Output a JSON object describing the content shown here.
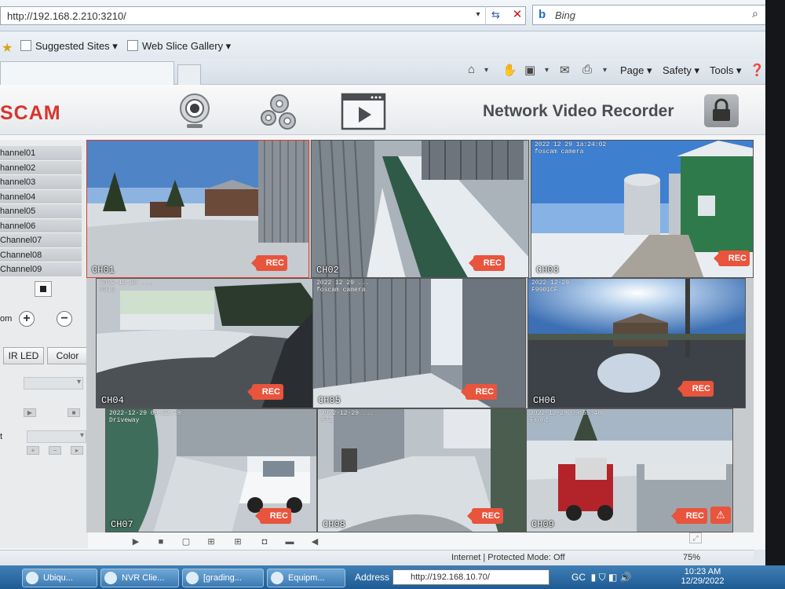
{
  "browser": {
    "url": "http://192.168.2.210:3210/",
    "search_placeholder": "Bing",
    "favorites": [
      "Suggested Sites ▾",
      "Web Slice Gallery ▾"
    ],
    "commands": {
      "page": "Page ▾",
      "safety": "Safety ▾",
      "tools": "Tools ▾"
    }
  },
  "app": {
    "logo": "SCAM",
    "title": "Network Video Recorder",
    "header_icons": [
      "camera-icon",
      "settings-gears-icon",
      "playback-icon",
      "lock-icon"
    ]
  },
  "sidebar": {
    "channels": [
      "hannel01",
      "hannel02",
      "hannel03",
      "hannel04",
      "hannel05",
      "hannel06",
      "Channel07",
      "Channel08",
      "Channel09"
    ],
    "zoom_label": "om",
    "ir_led_label": "IR LED",
    "color_label": "Color",
    "t_label": "t"
  },
  "cameras": [
    {
      "id": "CH01",
      "label": "CH01",
      "osd": "",
      "rec": "REC",
      "selected": true
    },
    {
      "id": "CH02",
      "label": "CH02",
      "osd": "",
      "rec": "REC"
    },
    {
      "id": "CH03",
      "label": "CH03",
      "osd": "2022 12 29 1a:24:02\nfoscam camera",
      "rec": "REC"
    },
    {
      "id": "CH04",
      "label": "CH04",
      "osd": "2022-12-29 ...\n0315",
      "rec": "REC"
    },
    {
      "id": "CH05",
      "label": "CH05",
      "osd": "2022 12 29 ...\nfoscam camera",
      "rec": "REC"
    },
    {
      "id": "CH06",
      "label": "CH06",
      "osd": "2022-12-29 ...\nF9901CF",
      "rec": "REC"
    },
    {
      "id": "CH07",
      "label": "CH07",
      "osd": "2022-12-29 09:22:49\nDriveway",
      "rec": "REC"
    },
    {
      "id": "CH08",
      "label": "CH08",
      "osd": "2022-12-29 ...\nPTZ",
      "rec": "REC"
    },
    {
      "id": "CH09",
      "label": "CH09",
      "osd": "2022-12-29 09:55:48\nFront",
      "rec": "REC"
    }
  ],
  "status": {
    "security": "Internet | Protected Mode: Off",
    "zoom": "75%"
  },
  "taskbar": {
    "tasks": [
      "Ubiqu...",
      "NVR Clie...",
      "[grading...",
      "Equipm..."
    ],
    "address_label": "Address",
    "address_value": "http://192.168.10.70/",
    "gc": "GC",
    "time": "10:23 AM",
    "date": "12/29/2022"
  },
  "colors": {
    "brand_red": "#d8342c",
    "rec_bg": "#e8543c",
    "taskbar": "#2a6aa5"
  }
}
